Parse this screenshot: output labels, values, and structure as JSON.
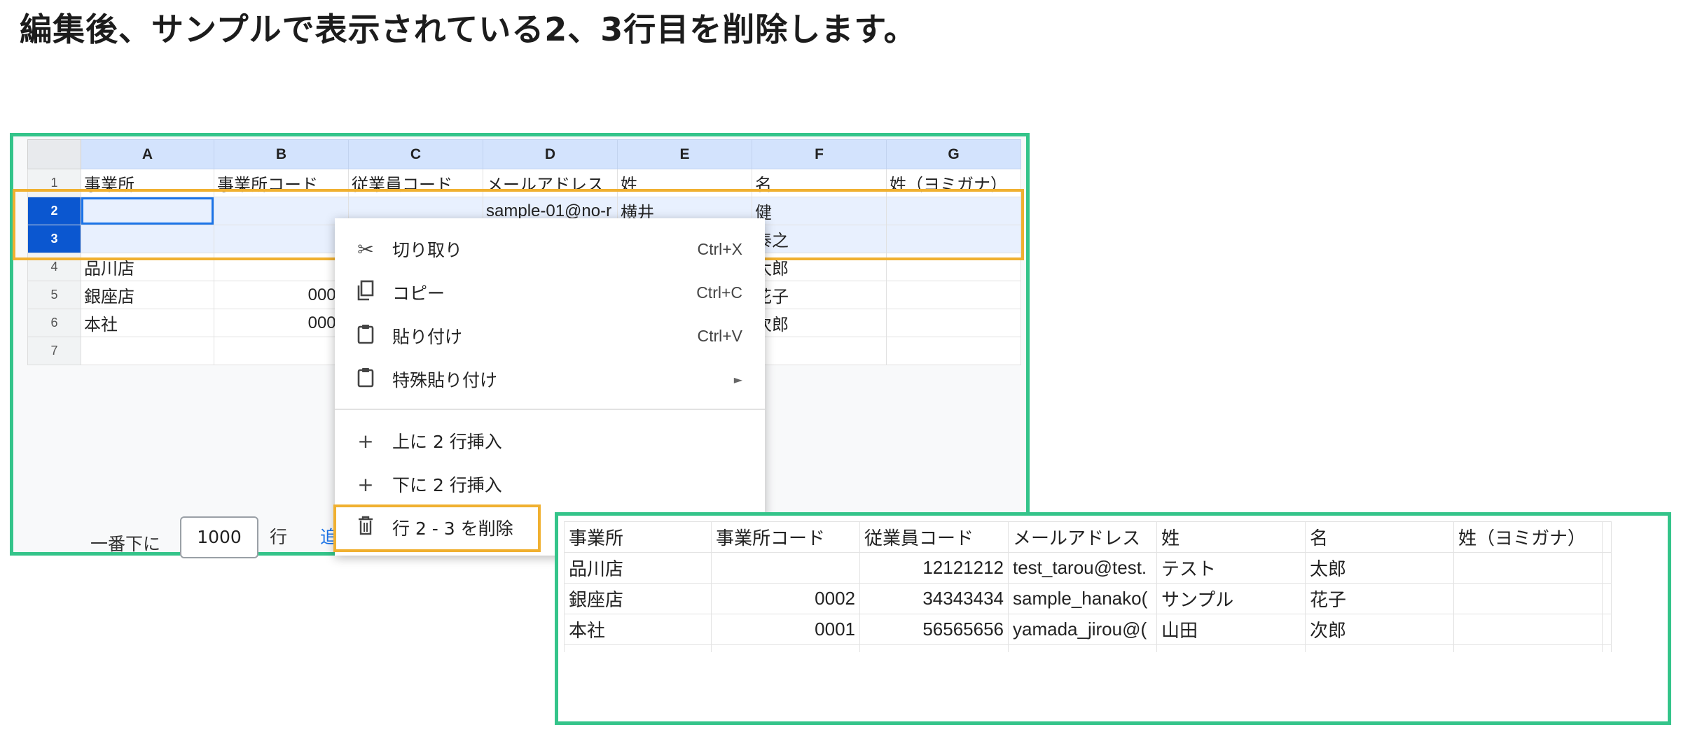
{
  "heading": "編集後、サンプルで表示されている2、3行目を削除します。",
  "sheet": {
    "columns": [
      "A",
      "B",
      "C",
      "D",
      "E",
      "F",
      "G"
    ],
    "rows": [
      {
        "n": "1",
        "cells": [
          "事業所",
          "事業所コード",
          "従業員コード",
          "メールアドレス",
          "姓",
          "名",
          "姓（ヨミガナ）"
        ]
      },
      {
        "n": "2",
        "cells": [
          "",
          "",
          "",
          "sample-01@no-r",
          "横井",
          "健",
          ""
        ]
      },
      {
        "n": "3",
        "cells": [
          "",
          "",
          "",
          "",
          "",
          "泰之",
          ""
        ]
      },
      {
        "n": "4",
        "cells": [
          "品川店",
          "",
          "",
          "",
          "",
          "太郎",
          ""
        ]
      },
      {
        "n": "5",
        "cells": [
          "銀座店",
          "0002",
          "",
          "",
          "",
          "花子",
          ""
        ]
      },
      {
        "n": "6",
        "cells": [
          "本社",
          "0001",
          "",
          "",
          "",
          "次郎",
          ""
        ]
      },
      {
        "n": "7",
        "cells": [
          "",
          "",
          "",
          "",
          "",
          "",
          ""
        ]
      }
    ],
    "bottom_label": "一番下に",
    "row_count": "1000",
    "row_unit": "行",
    "add_link": "追加"
  },
  "context_menu": {
    "cut": {
      "label": "切り取り",
      "shortcut": "Ctrl+X"
    },
    "copy": {
      "label": "コピー",
      "shortcut": "Ctrl+C"
    },
    "paste": {
      "label": "貼り付け",
      "shortcut": "Ctrl+V"
    },
    "paste_special": {
      "label": "特殊貼り付け"
    },
    "insert_above": {
      "label": "上に 2 行挿入"
    },
    "insert_below": {
      "label": "下に 2 行挿入"
    },
    "delete_rows": {
      "label": "行 2 - 3 を削除"
    }
  },
  "result": {
    "rows": [
      [
        "事業所",
        "事業所コード",
        "従業員コード",
        "メールアドレス",
        "姓",
        "名",
        "姓（ヨミガナ）",
        ""
      ],
      [
        "品川店",
        "",
        "12121212",
        "test_tarou@test.",
        "テスト",
        "太郎",
        "",
        ""
      ],
      [
        "銀座店",
        "0002",
        "34343434",
        "sample_hanako(",
        "サンプル",
        "花子",
        "",
        ""
      ],
      [
        "本社",
        "0001",
        "56565656",
        "yamada_jirou@(",
        "山田",
        "次郎",
        "",
        ""
      ]
    ]
  },
  "colors": {
    "frame": "#34c48a",
    "highlight": "#f0b030",
    "selected_row": "#0b57d0",
    "header": "#d3e3fd"
  }
}
